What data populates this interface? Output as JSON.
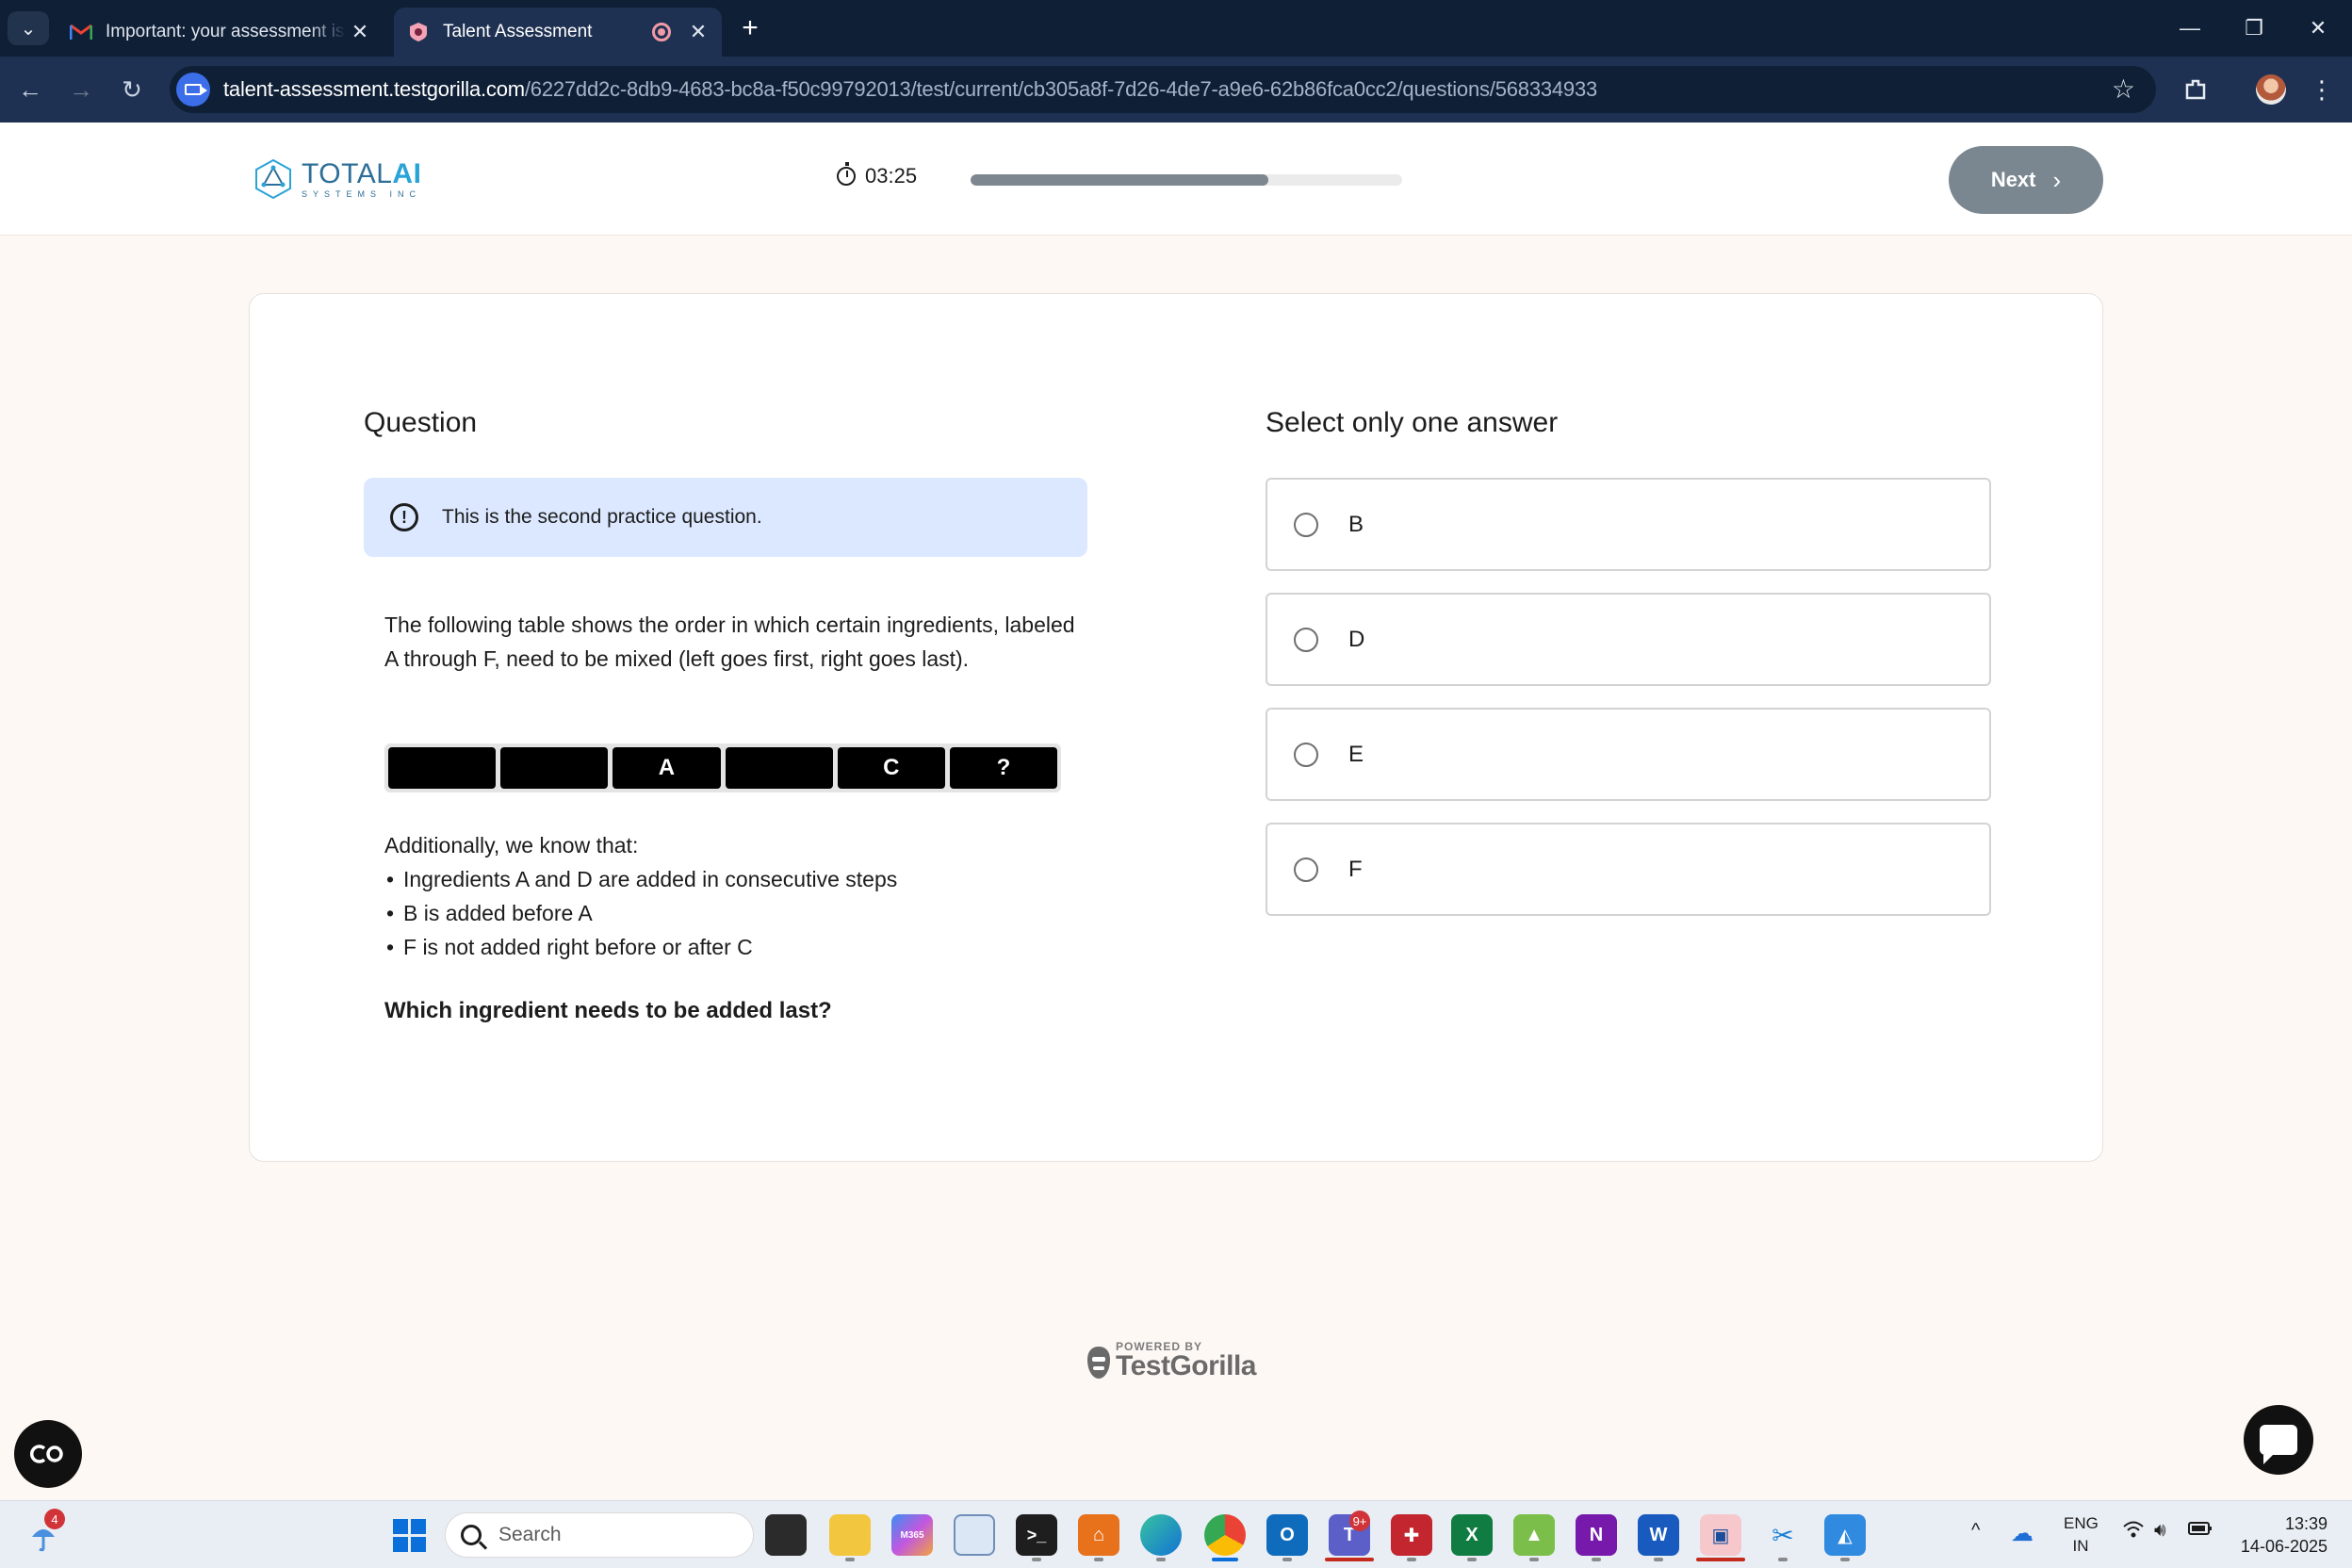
{
  "browser": {
    "tabs": [
      {
        "title": "Important: your assessment is w",
        "favicon": "gmail-icon"
      },
      {
        "title": "Talent Assessment",
        "favicon": "testgorilla-icon",
        "recording": true
      }
    ],
    "url_host": "talent-assessment.testgorilla.com",
    "url_path": "/6227dd2c-8db9-4683-bc8a-f50c99792013/test/current/cb305a8f-7d26-4de7-a9e6-62b86fca0cc2/questions/568334933"
  },
  "header": {
    "logo_primary": "TOTAL",
    "logo_accent": "AI",
    "logo_sub": "SYSTEMS INC",
    "timer": "03:25",
    "progress_fraction": 0.69,
    "next_label": "Next"
  },
  "question": {
    "heading": "Question",
    "notice": "This is the second practice question.",
    "body": "The following table shows the order in which certain ingredients, labeled A through F, need to be mixed (left goes first, right goes last).",
    "sequence": [
      "",
      "",
      "A",
      "",
      "C",
      "?"
    ],
    "additional_intro": "Additionally, we know that:",
    "facts": [
      "Ingredients A and D are added in consecutive steps",
      "B is added before A",
      "F is not added right before or after C"
    ],
    "ask": "Which ingredient needs to be added last?"
  },
  "answers": {
    "heading": "Select only one answer",
    "options": [
      "B",
      "D",
      "E",
      "F"
    ]
  },
  "footer": {
    "powered_by": "POWERED BY",
    "brand": "TestGorilla"
  },
  "taskbar": {
    "weather_badge": "4",
    "search_placeholder": "Search",
    "teams_badge": "9+",
    "lang_line1": "ENG",
    "lang_line2": "IN",
    "time": "13:39",
    "date": "14-06-2025"
  },
  "colors": {
    "accent_blue": "#2aa3d6",
    "next_button": "#7a8790",
    "notice_bg": "#dbe8ff"
  }
}
